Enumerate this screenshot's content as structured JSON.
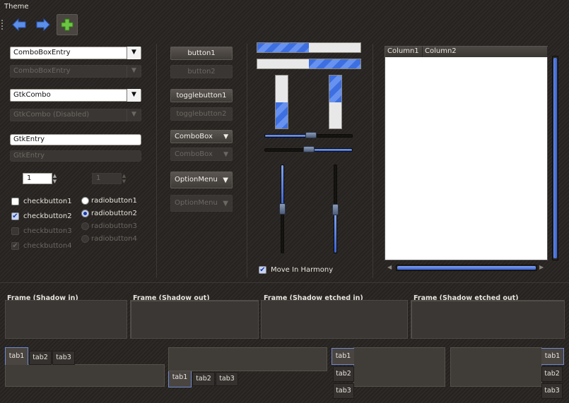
{
  "window_title": "Theme",
  "toolbar": {
    "back_icon": "back-arrow-icon",
    "forward_icon": "forward-arrow-icon",
    "add_icon": "add-plus-icon"
  },
  "col1": {
    "combo_entry": "ComboBoxEntry",
    "combo_entry_disabled": "ComboBoxEntry",
    "gtk_combo": "GtkCombo",
    "gtk_combo_disabled": "GtkCombo (Disabled)",
    "gtk_entry": "GtkEntry",
    "gtk_entry_disabled": "GtkEntry",
    "spin_value": "1",
    "spin_disabled_value": "1",
    "checks": [
      "checkbutton1",
      "checkbutton2",
      "checkbutton3",
      "checkbutton4"
    ],
    "radios": [
      "radiobutton1",
      "radiobutton2",
      "radiobutton3",
      "radiobutton4"
    ]
  },
  "col2": {
    "button1": "button1",
    "button2": "button2",
    "toggle1": "togglebutton1",
    "toggle2": "togglebutton2",
    "combobox": "ComboBox",
    "combobox_disabled": "ComboBox",
    "optionmenu": "OptionMenu",
    "optionmenu_disabled": "OptionMenu"
  },
  "col3": {
    "progress_h1": 0.5,
    "progress_h2": 0.5,
    "progress_v1": 0.5,
    "progress_v2": 0.5,
    "move_in_harmony": "Move In Harmony"
  },
  "tree": {
    "columns": [
      "Column1",
      "Column2"
    ]
  },
  "frames": [
    "Frame (Shadow in)",
    "Frame (Shadow out)",
    "Frame (Shadow etched in)",
    "Frame (Shadow etched out)"
  ],
  "tabs": [
    "tab1",
    "tab2",
    "tab3"
  ],
  "colors": {
    "accent": "#3d6fe0",
    "background": "#2b2825"
  }
}
